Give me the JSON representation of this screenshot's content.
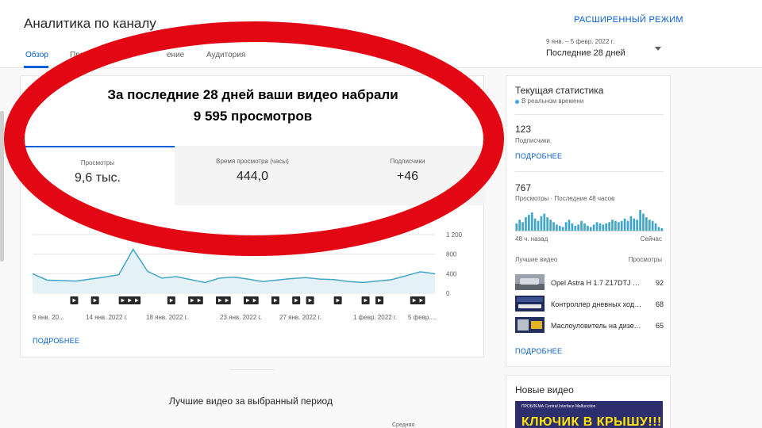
{
  "header": {
    "title": "Аналитика по каналу",
    "advanced_mode": "РАСШИРЕННЫЙ РЕЖИМ",
    "tabs": [
      {
        "label": "Обзор"
      },
      {
        "label": "Просмо"
      },
      {
        "label": "ение"
      },
      {
        "label": "Аудитория"
      }
    ],
    "date_range": "9 янв. – 5 февр. 2022 г.",
    "date_label": "Последние 28 дней"
  },
  "main": {
    "headline_line1": "За последние 28 дней ваши видео набрали",
    "headline_line2": "9 595 просмотров",
    "metrics": [
      {
        "label": "Просмотры",
        "value": "9,6 тыс."
      },
      {
        "label": "Время просмотра (часы)",
        "value": "444,0"
      },
      {
        "label": "Подписчики",
        "value": "+46"
      }
    ],
    "more_link": "ПОДРОБНЕЕ"
  },
  "chart_data": {
    "type": "area",
    "x_tick_labels": [
      "9 янв. 20...",
      "14 янв. 2022 г.",
      "18 янв. 2022 г.",
      "23 янв. 2022 г.",
      "27 янв. 2022 г.",
      "1 февр. 2022 г.",
      "5 февр...."
    ],
    "y_ticks": [
      0,
      400,
      800,
      1200
    ],
    "y_tick_labels": [
      "0",
      "400",
      "800",
      "1 200"
    ],
    "ylim": [
      0,
      1200
    ],
    "values": [
      400,
      270,
      260,
      250,
      290,
      330,
      380,
      900,
      450,
      310,
      340,
      280,
      220,
      310,
      330,
      290,
      240,
      270,
      300,
      320,
      290,
      280,
      240,
      220,
      250,
      280,
      360,
      440,
      400
    ],
    "grid": true,
    "video_markers": [
      6,
      9,
      13,
      14,
      15,
      20,
      23,
      24,
      27,
      28,
      31,
      32,
      35,
      38,
      40,
      44,
      48,
      50,
      55,
      56
    ],
    "marker_icon": "play-icon"
  },
  "realtime": {
    "title": "Текущая статистика",
    "live_label": "В реальном времени",
    "subscribers_value": "123",
    "subscribers_label": "Подписчики",
    "more_link_1": "ПОДРОБНЕЕ",
    "views_value": "767",
    "views_label": "Просмотры · Последние 48 часов",
    "bars_left_label": "48 ч. назад",
    "bars_right_label": "Сейчас",
    "bars": [
      12,
      18,
      14,
      22,
      26,
      30,
      20,
      16,
      24,
      28,
      22,
      18,
      14,
      10,
      8,
      6,
      14,
      18,
      12,
      8,
      10,
      16,
      12,
      8,
      6,
      10,
      14,
      12,
      10,
      12,
      14,
      18,
      16,
      14,
      16,
      20,
      16,
      24,
      20,
      18,
      34,
      28,
      22,
      18,
      16,
      12,
      6,
      4
    ],
    "top_videos_label": "Лучшие видео",
    "top_videos_col": "Просмотры",
    "top_videos": [
      {
        "title": "Opel Astra H 1.7 Z17DTJ EC...",
        "count": "92"
      },
      {
        "title": "Контроллер дневных ходо...",
        "count": "68"
      },
      {
        "title": "Маслоуловитель на дизел...",
        "count": "65"
      }
    ],
    "more_link_2": "ПОДРОБНЕЕ"
  },
  "new_videos": {
    "title": "Новые видео",
    "thumb_text": "КЛЮЧИК В КРЫШУ!!!",
    "thumb_top": "ПРОБЛЕМА Central Interface Malfunction"
  },
  "bottom": {
    "section_title": "Лучшие видео за выбранный период",
    "cut_label": "Средняя"
  },
  "colors": {
    "accent": "#065fd4",
    "chart_line": "#41a6c8",
    "chart_fill": "#e4f1f6",
    "overlay_ring": "#e30613"
  }
}
